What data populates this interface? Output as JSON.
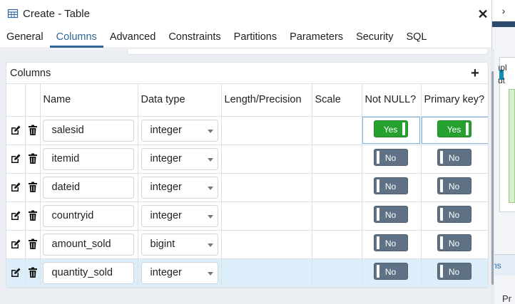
{
  "dialog": {
    "title": "Create - Table",
    "close_glyph": "✕"
  },
  "tabs": [
    {
      "label": "General",
      "active": false
    },
    {
      "label": "Columns",
      "active": true
    },
    {
      "label": "Advanced",
      "active": false
    },
    {
      "label": "Constraints",
      "active": false
    },
    {
      "label": "Partitions",
      "active": false
    },
    {
      "label": "Parameters",
      "active": false
    },
    {
      "label": "Security",
      "active": false
    },
    {
      "label": "SQL",
      "active": false
    }
  ],
  "columns_panel": {
    "title": "Columns",
    "add_glyph": "+",
    "headers": [
      "",
      "",
      "Name",
      "Data type",
      "Length/Precision",
      "Scale",
      "Not NULL?",
      "Primary key?"
    ],
    "rows": [
      {
        "name": "salesid",
        "data_type": "integer",
        "length": "",
        "scale": "",
        "not_null": "Yes",
        "primary_key": "Yes",
        "selected": false
      },
      {
        "name": "itemid",
        "data_type": "integer",
        "length": "",
        "scale": "",
        "not_null": "No",
        "primary_key": "No",
        "selected": false
      },
      {
        "name": "dateid",
        "data_type": "integer",
        "length": "",
        "scale": "",
        "not_null": "No",
        "primary_key": "No",
        "selected": false
      },
      {
        "name": "countryid",
        "data_type": "integer",
        "length": "",
        "scale": "",
        "not_null": "No",
        "primary_key": "No",
        "selected": false
      },
      {
        "name": "amount_sold",
        "data_type": "bigint",
        "length": "",
        "scale": "",
        "not_null": "No",
        "primary_key": "No",
        "selected": false
      },
      {
        "name": "quantity_sold",
        "data_type": "integer",
        "length": "",
        "scale": "",
        "not_null": "No",
        "primary_key": "No",
        "selected": true
      }
    ]
  },
  "background": {
    "menu_glyph": "☰",
    "fragment_1": "ıpl",
    "fragment_2": "ut",
    "tab_fragment": "ns",
    "fragment_3": "Pr",
    "tabs_next_glyph": "›"
  },
  "colors": {
    "accent": "#326599",
    "toggle_on": "#26a130",
    "toggle_off": "#5f7285",
    "selected_row": "#dbeef9"
  },
  "icons": {
    "title": "table-icon",
    "edit": "edit-icon",
    "delete": "trash-icon",
    "close": "close-icon",
    "add": "plus-icon"
  }
}
